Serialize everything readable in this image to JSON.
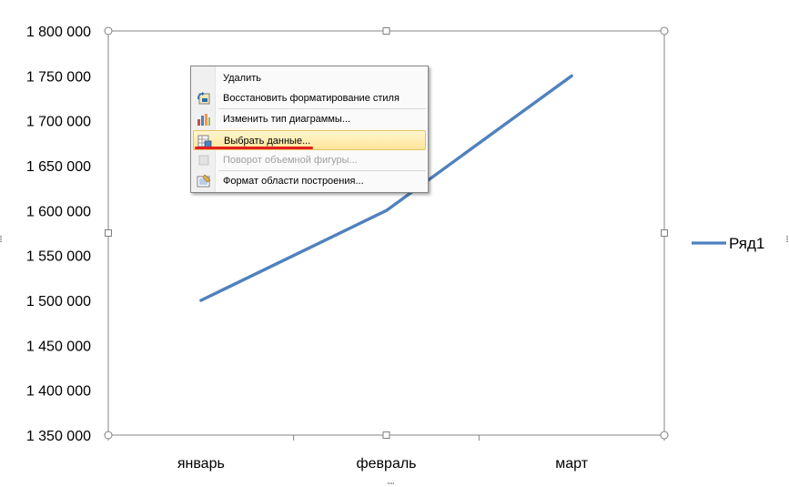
{
  "chart_data": {
    "type": "line",
    "categories": [
      "январь",
      "февраль",
      "март"
    ],
    "series": [
      {
        "name": "Ряд1",
        "values": [
          1500000,
          1600000,
          1750000
        ],
        "color": "#4f81bd"
      }
    ],
    "y_ticks": [
      1350000,
      1400000,
      1450000,
      1500000,
      1550000,
      1600000,
      1650000,
      1700000,
      1750000,
      1800000
    ],
    "y_tick_labels": [
      "1 350 000",
      "1 400 000",
      "1 450 000",
      "1 500 000",
      "1 550 000",
      "1 600 000",
      "1 650 000",
      "1 700 000",
      "1 750 000",
      "1 800 000"
    ],
    "ylim": [
      1350000,
      1800000
    ],
    "grid": false,
    "legend": "right",
    "title": "",
    "xlabel": "",
    "ylabel": ""
  },
  "context_menu": {
    "items": [
      {
        "label": "Удалить",
        "icon": "delete-icon",
        "enabled": true,
        "highlighted": false
      },
      {
        "label": "Восстановить форматирование стиля",
        "icon": "reset-style-icon",
        "enabled": true,
        "highlighted": false
      },
      {
        "label": "Изменить тип диаграммы...",
        "icon": "chart-type-icon",
        "enabled": true,
        "highlighted": false
      },
      {
        "label": "Выбрать данные...",
        "icon": "select-data-icon",
        "enabled": true,
        "highlighted": true
      },
      {
        "label": "Поворот объемной фигуры...",
        "icon": "3d-rotation-icon",
        "enabled": false,
        "highlighted": false
      },
      {
        "label": "Формат области построения...",
        "icon": "format-plot-area-icon",
        "enabled": true,
        "highlighted": false
      }
    ]
  },
  "colors": {
    "series_line": "#4f81bd",
    "highlight_underline": "#e41f1f",
    "plot_border": "#868686",
    "menu_highlight": "#ffe59a"
  }
}
